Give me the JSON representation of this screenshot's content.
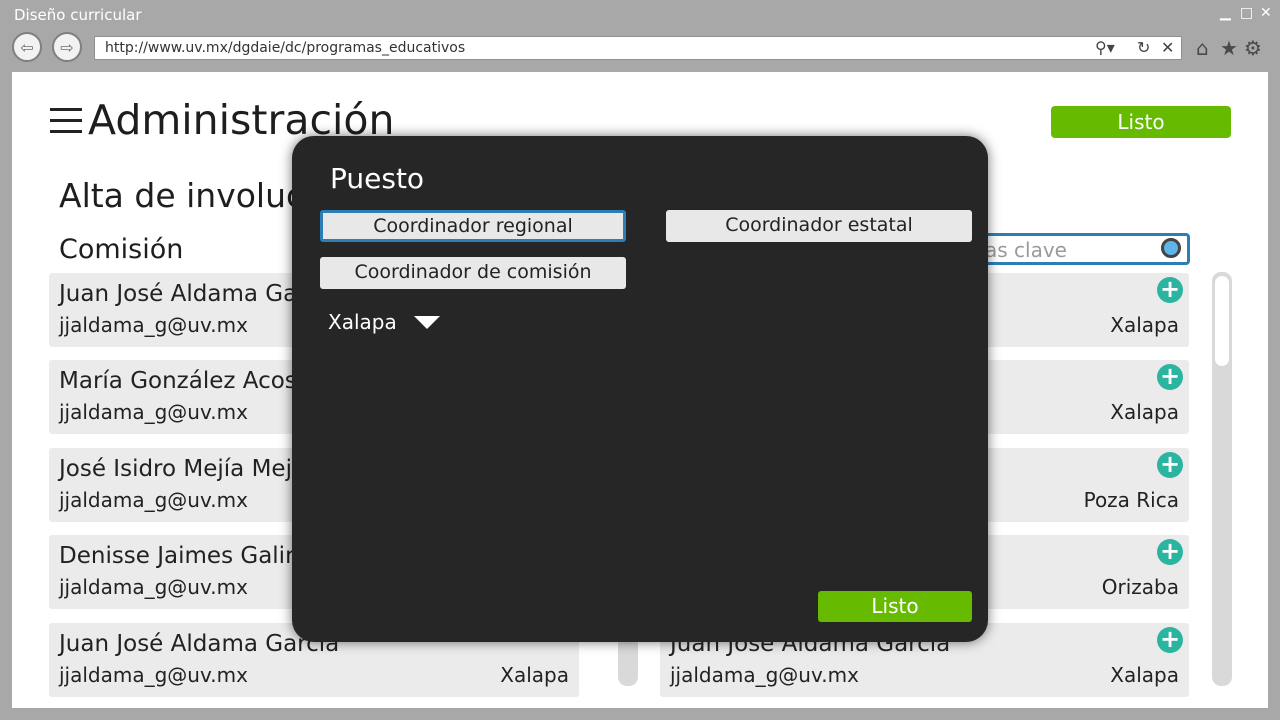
{
  "window": {
    "title": "Diseño curricular"
  },
  "browser": {
    "url": "http://www.uv.mx/dgdaie/dc/programas_educativos"
  },
  "page": {
    "title": "Administración",
    "subtitle": "Alta de involuc",
    "done_label": "Listo",
    "section_label": "Comisión",
    "search_placeholder": "as clave"
  },
  "left_list": [
    {
      "name": "Juan José Aldama Ga",
      "email": "jjaldama_g@uv.mx"
    },
    {
      "name": "María González Acos",
      "email": "jjaldama_g@uv.mx"
    },
    {
      "name": "José Isidro Mejía Meji",
      "email": "jjaldama_g@uv.mx"
    },
    {
      "name": "Denisse Jaimes Galin",
      "email": "jjaldama_g@uv.mx"
    },
    {
      "name": "Juan José Aldama García",
      "email": "jjaldama_g@uv.mx",
      "city": "Xalapa"
    }
  ],
  "right_list": [
    {
      "name": "",
      "email": "",
      "city": "Xalapa"
    },
    {
      "name": "",
      "email": "",
      "city": "Xalapa"
    },
    {
      "name": "",
      "email": "",
      "city": "Poza Rica"
    },
    {
      "name": "",
      "email": "",
      "city": "Orizaba"
    },
    {
      "name": "Juan José Aldama García",
      "email": "jjaldama_g@uv.mx",
      "city": "Xalapa"
    }
  ],
  "modal": {
    "title": "Puesto",
    "options": [
      "Coordinador regional",
      "Coordinador estatal",
      "Coordinador de comisión"
    ],
    "selected_option": "Coordinador regional",
    "dropdown_value": "Xalapa",
    "done_label": "Listo"
  },
  "colors": {
    "accent_green": "#66bb00",
    "focus_blue": "#2b7fb4",
    "add_icon_teal": "#2bb5a0",
    "modal_bg": "#262626"
  },
  "icons": [
    "back-arrow-icon",
    "forward-arrow-icon",
    "search-icon",
    "refresh-icon",
    "close-icon",
    "home-icon",
    "star-icon",
    "gear-icon",
    "hamburger-menu-icon",
    "plus-circle-icon",
    "dropdown-arrow-icon"
  ]
}
